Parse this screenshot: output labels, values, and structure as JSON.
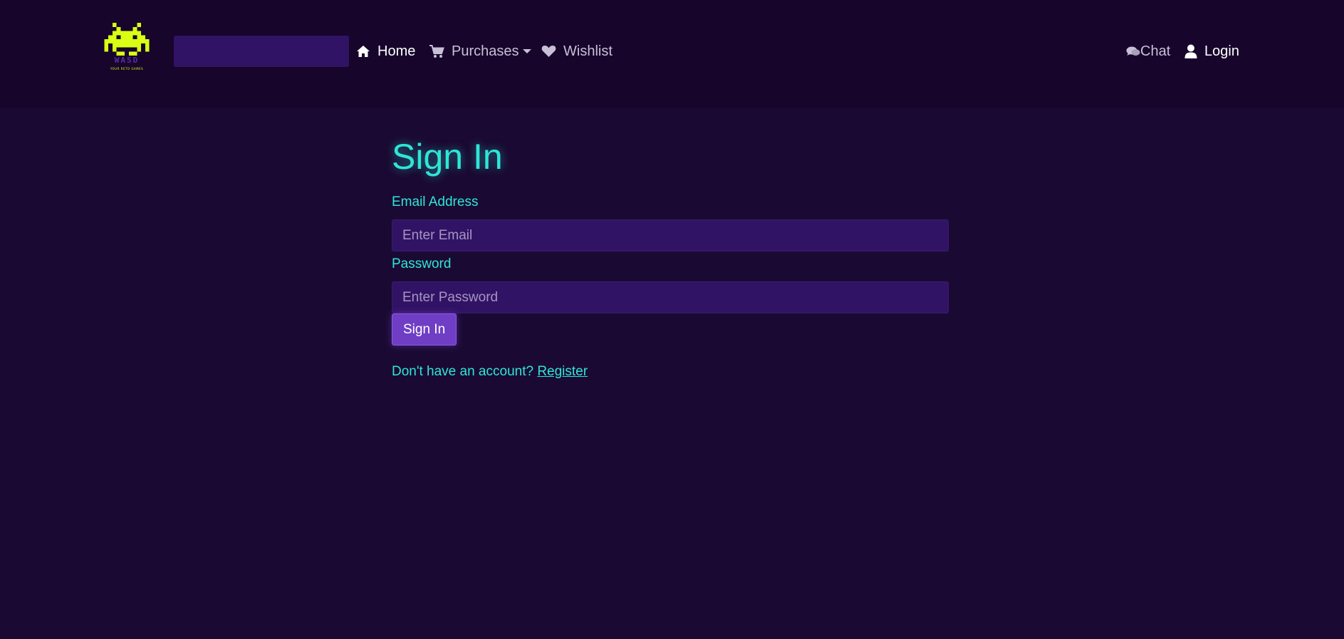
{
  "nav": {
    "logo_text": "WASD",
    "logo_subtext": "YOUR RETO GAMES",
    "home_label": "Home",
    "purchases_label": "Purchases",
    "wishlist_label": "Wishlist",
    "chat_label": "Chat",
    "login_label": "Login"
  },
  "form": {
    "title": "Sign In",
    "email_label": "Email Address",
    "email_placeholder": "Enter Email",
    "password_label": "Password",
    "password_placeholder": "Enter Password",
    "submit_label": "Sign In",
    "register_prompt": "Don't have an account?",
    "register_link": "Register"
  },
  "colors": {
    "background": "#1a0a33",
    "navbar": "#17052b",
    "accent_cyan": "#2ee6d6",
    "input_bg": "#311365",
    "button_bg": "#6f3ec5",
    "logo_yellow": "#d8ff14"
  },
  "icons": {
    "logo": "space-invader-logo",
    "home": "home-icon",
    "purchases": "cart-icon",
    "wishlist": "heart-icon",
    "chat": "chat-icon",
    "login": "user-icon"
  }
}
